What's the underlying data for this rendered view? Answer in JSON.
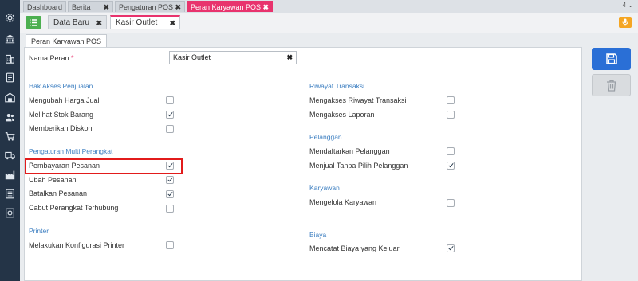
{
  "top_tabs": [
    {
      "label": "Dashboard",
      "closable": false
    },
    {
      "label": "Berita",
      "closable": true
    },
    {
      "label": "Pengaturan POS",
      "closable": true
    },
    {
      "label": "Peran Karyawan POS",
      "closable": true
    }
  ],
  "tab_count": "4",
  "sub_tabs": [
    {
      "label": "Data Baru"
    },
    {
      "label": "Kasir Outlet"
    }
  ],
  "inner_tab": "Peran Karyawan POS",
  "form": {
    "nama_peran_label": "Nama Peran",
    "required_mark": "*",
    "nama_peran_value": "Kasir Outlet",
    "clear": "✖"
  },
  "sections": {
    "hak_akses": {
      "title": "Hak Akses Penjualan",
      "items": [
        {
          "label": "Mengubah Harga Jual",
          "checked": false
        },
        {
          "label": "Melihat Stok Barang",
          "checked": true
        },
        {
          "label": "Memberikan Diskon",
          "checked": false
        }
      ]
    },
    "multi_perangkat": {
      "title": "Pengaturan Multi Perangkat",
      "items": [
        {
          "label": "Pembayaran Pesanan",
          "checked": true
        },
        {
          "label": "Ubah Pesanan",
          "checked": true
        },
        {
          "label": "Batalkan Pesanan",
          "checked": true
        },
        {
          "label": "Cabut Perangkat Terhubung",
          "checked": false
        }
      ]
    },
    "printer": {
      "title": "Printer",
      "items": [
        {
          "label": "Melakukan Konfigurasi Printer",
          "checked": false
        }
      ]
    },
    "riwayat": {
      "title": "Riwayat Transaksi",
      "items": [
        {
          "label": "Mengakses Riwayat Transaksi",
          "checked": false
        },
        {
          "label": "Mengakses Laporan",
          "checked": false
        }
      ]
    },
    "pelanggan": {
      "title": "Pelanggan",
      "items": [
        {
          "label": "Mendaftarkan Pelanggan",
          "checked": false
        },
        {
          "label": "Menjual Tanpa Pilih Pelanggan",
          "checked": true
        }
      ]
    },
    "karyawan": {
      "title": "Karyawan",
      "items": [
        {
          "label": "Mengelola Karyawan",
          "checked": false
        }
      ]
    },
    "biaya": {
      "title": "Biaya",
      "items": [
        {
          "label": "Mencatat Biaya yang Keluar",
          "checked": true
        }
      ]
    }
  },
  "colors": {
    "sidebar": "#243447",
    "accent": "#e8336d",
    "save": "#2a6fd6",
    "highlight": "#e21b1b"
  },
  "sidebar_icons": [
    "gear-icon",
    "bank-icon",
    "building-icon",
    "book-icon",
    "store-icon",
    "users-icon",
    "cart-icon",
    "truck-icon",
    "factory-icon",
    "report-icon",
    "chart-icon"
  ]
}
